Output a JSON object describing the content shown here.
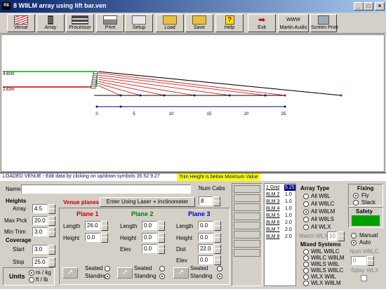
{
  "window": {
    "title": "8 W8LM array using lift bar.ven",
    "app_icon": "R8",
    "min": "_",
    "max": "□",
    "close": "×"
  },
  "toolbar": [
    {
      "label": "Venue",
      "icon": "venue-icon"
    },
    {
      "label": "Array",
      "icon": "array-icon"
    },
    {
      "label": "Processor",
      "icon": "processor-icon"
    },
    {
      "label": "Print",
      "icon": "print-icon"
    },
    {
      "label": "Setup",
      "icon": "setup-icon"
    },
    {
      "label": "Load",
      "icon": "load-icon"
    },
    {
      "label": "Save",
      "icon": "save-icon"
    },
    {
      "label": "Help",
      "icon": "help-icon"
    },
    {
      "label": "Exit",
      "icon": "exit-icon"
    },
    {
      "label": "Martin Audio",
      "icon": "www-icon",
      "icon_text": "WWW"
    },
    {
      "label": "Screen Print",
      "icon": "screen-print-icon"
    }
  ],
  "canvas": {
    "label_top": "4.60m",
    "label_bottom": "2.63m",
    "ticks": [
      "0",
      "5",
      "10",
      "15",
      "20",
      "25"
    ]
  },
  "status": {
    "text": "LOADED VENUE - Edit data by clicking on up/down symbols   35.52  9.27",
    "warning": "Trim Height is below Minimum Value"
  },
  "name": {
    "label": "Name",
    "value": ""
  },
  "num_cabs": {
    "label": "Num Cabs",
    "value": "8"
  },
  "heights": {
    "title": "Heights",
    "array_label": "Array",
    "array": "4.5",
    "max_pick_label": "Max Pick",
    "max_pick": "20.0",
    "min_trim_label": "Min Trim",
    "min_trim": "3.0"
  },
  "coverage": {
    "title": "Coverage",
    "start_label": "Start",
    "start": "3.0",
    "stop_label": "Stop",
    "stop": "25.0"
  },
  "units": {
    "title": "Units",
    "opt1": "m / kg",
    "opt2": "ft / lb"
  },
  "venue_planes": {
    "title": "Venue planes",
    "button": "Enter Using Laser + Inclinometer"
  },
  "plane1": {
    "title": "Plane 1",
    "length_label": "Length",
    "length": "26.0",
    "height_label": "Height",
    "height": "0.0",
    "seated": "Seated",
    "standing": "Standing"
  },
  "plane2": {
    "title": "Plane 2",
    "length_label": "Length",
    "length": "0.0",
    "height_label": "Height",
    "height": "0.0",
    "elev_label": "Elev",
    "elev": "0.0",
    "seated": "Seated",
    "standing": "Standing"
  },
  "plane3": {
    "title": "Plane 3",
    "length_label": "Length",
    "length": "0.0",
    "height_label": "Height",
    "height": "0.0",
    "dist_label": "Dist",
    "dist": "22.0",
    "elev_label": "Elev",
    "elev": "0.0",
    "seated": "Seated",
    "standing": "Standing"
  },
  "array_list": [
    {
      "name": "1 Grid",
      "value": "5.25"
    },
    {
      "name": "8LM 2",
      "value": "1.0"
    },
    {
      "name": "8LM 3",
      "value": "1.0"
    },
    {
      "name": "8LM 4",
      "value": "1.0"
    },
    {
      "name": "8LM 5",
      "value": "1.0"
    },
    {
      "name": "8LM 6",
      "value": "2.0"
    },
    {
      "name": "8LM 7",
      "value": "2.0"
    },
    {
      "name": "8LM 8",
      "value": "2.0"
    }
  ],
  "array_type": {
    "title": "Array Type",
    "options": [
      "All W8L",
      "All W8LC",
      "All W8LM",
      "All W8LS",
      "All WLX"
    ],
    "selected": 2,
    "match_label": "Match WLX",
    "match_value": "10"
  },
  "mixed": {
    "title": "Mixed Systems",
    "options": [
      "W8L W8LC",
      "W8LC W8LM",
      "W8LS W8L",
      "W8LS W8LC",
      "WLX W8L",
      "WLX W8LM"
    ]
  },
  "fixing": {
    "title": "Fixing",
    "fly": "Fly",
    "stack": "Stack"
  },
  "safety": {
    "title": "Safety",
    "color": "#00a000"
  },
  "mode": {
    "manual": "Manual",
    "auto": "Auto"
  },
  "num_w8lc": {
    "label": "Num W8LC",
    "value": "0"
  },
  "splay_wlx": {
    "label": "Splay WLX"
  }
}
